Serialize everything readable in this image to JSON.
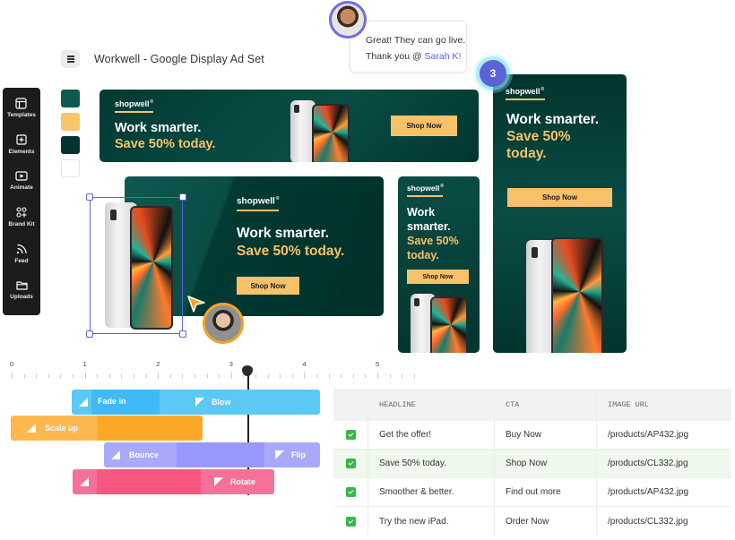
{
  "header": {
    "menu_icon": "hamburger-icon",
    "title": "Workwell - Google Display Ad Set"
  },
  "sidebar": {
    "items": [
      {
        "label": "Templates",
        "icon": "templates-icon"
      },
      {
        "label": "Elements",
        "icon": "plus-square-icon"
      },
      {
        "label": "Animate",
        "icon": "play-icon"
      },
      {
        "label": "Brand Kit",
        "icon": "brand-kit-icon"
      },
      {
        "label": "Feed",
        "icon": "rss-icon"
      },
      {
        "label": "Uploads",
        "icon": "folder-icon"
      }
    ]
  },
  "brand_colors": [
    "#0e5a50",
    "#f9c46b",
    "#02332e",
    "#ffffff"
  ],
  "comment": {
    "line1": "Great! They can go live.",
    "line2_prefix": "Thank you @ ",
    "mention": "Sarah K!",
    "badge_count": "3"
  },
  "ads": {
    "brand": "shopwell",
    "brand_mark": "®",
    "headline_white": "Work smarter.",
    "headline_yellow": "Save 50% today.",
    "headline_yellow_part1": "Save 50%",
    "headline_yellow_part2": "today.",
    "tall_white_1": "Work",
    "tall_white_2": "smarter.",
    "cta": "Shop Now"
  },
  "timeline": {
    "ticks": [
      "0",
      "1",
      "2",
      "3",
      "4",
      "5"
    ],
    "playhead_position": 3.2,
    "tracks": [
      {
        "in": "Fade in",
        "out": "Blow",
        "color": "#5cc8f5"
      },
      {
        "in": "Scale up",
        "out": "",
        "color": "#fbae3c"
      },
      {
        "in": "Bounce",
        "out": "Flip",
        "color": "#a5a5fb"
      },
      {
        "in": "",
        "out": "Rotate",
        "color": "#f7678a"
      }
    ]
  },
  "feed_table": {
    "columns": [
      "HEADLINE",
      "CTA",
      "IMAGE URL"
    ],
    "rows": [
      {
        "checked": true,
        "headline": "Get the offer!",
        "cta": "Buy Now",
        "image_url": "/products/AP432.jpg"
      },
      {
        "checked": true,
        "headline": "Save 50% today.",
        "cta": "Shop Now",
        "image_url": "/products/CL332.jpg"
      },
      {
        "checked": true,
        "headline": "Smoother & better.",
        "cta": "Find out more",
        "image_url": "/products/AP432.jpg"
      },
      {
        "checked": true,
        "headline": "Try the new iPad.",
        "cta": "Order Now",
        "image_url": "/products/CL332.jpg"
      }
    ]
  }
}
